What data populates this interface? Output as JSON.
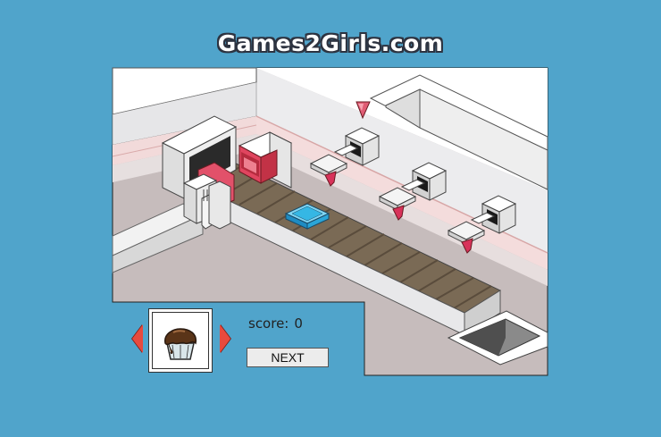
{
  "site": {
    "title": "Games2Girls.com"
  },
  "hud": {
    "score_label": "score:",
    "score_value": "0",
    "next_label": "NEXT"
  },
  "selector": {
    "item_icon": "chocolate-cupcake-icon",
    "prev_icon": "arrow-left-icon",
    "next_icon": "arrow-right-icon"
  },
  "colors": {
    "background": "#50a4cb",
    "arrow": "#e84a3e",
    "belt": "#7a6a55",
    "tray": "#35b7e4",
    "oven": "#e0455f"
  }
}
